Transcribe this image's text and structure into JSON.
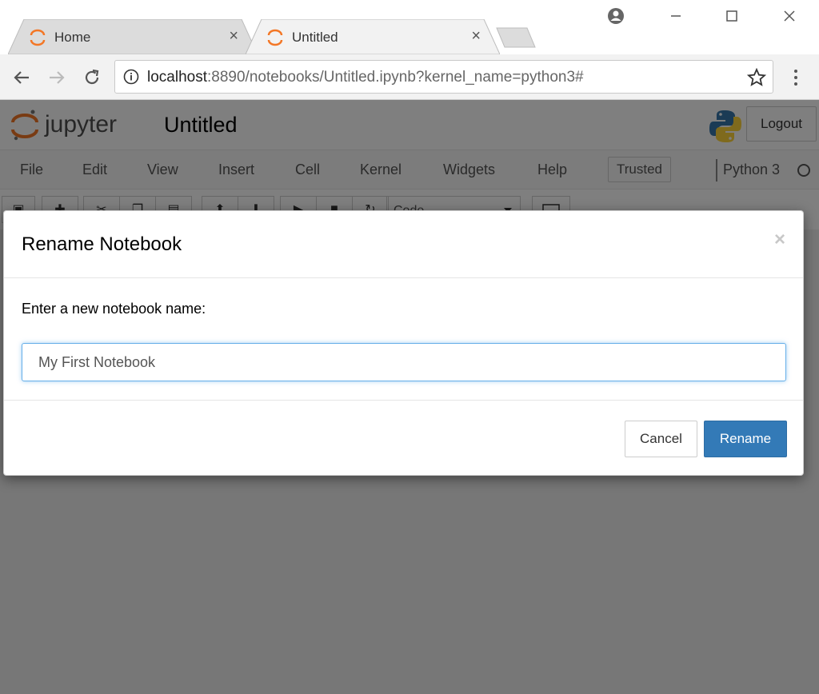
{
  "browser": {
    "tabs": [
      {
        "title": "Home",
        "favicon": "jupyter-favicon-icon",
        "close": "×"
      },
      {
        "title": "Untitled",
        "favicon": "jupyter-favicon-icon",
        "close": "×",
        "active": true
      }
    ],
    "address": {
      "host": "localhost",
      "path": ":8890/notebooks/Untitled.ipynb?kernel_name=python3#"
    }
  },
  "jupyter": {
    "logo_text": "jupyter",
    "notebook_name": "Untitled",
    "logout_label": "Logout",
    "menu": [
      "File",
      "Edit",
      "View",
      "Insert",
      "Cell",
      "Kernel",
      "Widgets",
      "Help"
    ],
    "trusted_label": "Trusted",
    "kernel_name": "Python 3",
    "cell_type": "Code"
  },
  "modal": {
    "title": "Rename Notebook",
    "close": "×",
    "prompt": "Enter a new notebook name:",
    "input_value": "My First Notebook",
    "cancel_label": "Cancel",
    "rename_label": "Rename"
  },
  "colors": {
    "primary": "#337ab7",
    "input_focus": "#66afe9",
    "jupyter_orange": "#f37726"
  }
}
